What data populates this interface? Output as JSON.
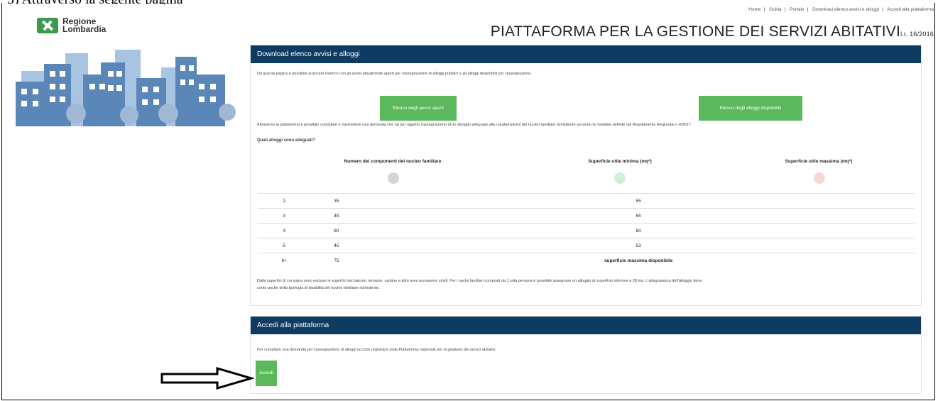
{
  "header": {
    "logo_text": [
      "Regione",
      "Lombardia"
    ],
    "links": [
      "Home",
      "Guida",
      "Portale",
      "Download elenco avvisi e alloggi",
      "Accedi alla piattaforma"
    ],
    "title": "PIATTAFORMA PER LA GESTIONE DEI SERVIZI ABITATIVI",
    "title_suffix": "l.r. 16/2016"
  },
  "download": {
    "heading": "Download elenco avvisi e alloggi",
    "intro": "Da questa pagina è possibile scaricare l'elenco con gli avvisi attualmente aperti per l'assegnazione di alloggi pubblici e gli alloggi disponibili per l'assegnazione.",
    "btn_avvisi": "Elenco degli avvisi aperti",
    "btn_alloggi": "Elenco degli alloggi disponibili",
    "text2": "Attraverso la piattaforma è possibile compilare e trasmettere una domanda che ha per oggetto l'assegnazione di un alloggio adeguato alle caratteristiche del nucleo familiare richiedente secondo le modalità definite dal Regolamento Regionale n.4/2017.",
    "question": "Quali alloggi sono adeguati?",
    "col1": "Numero dei componenti del nucleo familiare",
    "col2": "Superficie utile minima (mq*)",
    "col3": "Superficie utile massima (mq*)",
    "rows": [
      [
        "2",
        "35",
        "55"
      ],
      [
        "3",
        "45",
        "65"
      ],
      [
        "4",
        "60",
        "80"
      ],
      [
        "5",
        "45",
        "53"
      ],
      [
        "6+",
        "75",
        "superficie massima disponibile"
      ]
    ],
    "note1": "Dalle superfici di cui sopra sono escluse le superfici dei balconi, terrazze, cantine e altre aree accessorie simili. Per i nuclei familiari composti da 1 sola persona è possibile assegnare un alloggio di superficie inferiore a 28 mq. L'adeguatezza dell'alloggio tiene",
    "note2": "conto anche della tipologia di disabilità del nucleo familiare richiedente."
  },
  "access": {
    "heading": "Accedi alla piattaforma",
    "text": "Per compilare una domanda per l'assegnazione di alloggi occorre registrarsi sulla Piattaforma regionale per la gestione dei servizi abitativi.",
    "button": "Accedi"
  },
  "colors": {
    "nav": "#0d3b62",
    "button": "#5cb85c",
    "buildings": "#5b86b8"
  }
}
